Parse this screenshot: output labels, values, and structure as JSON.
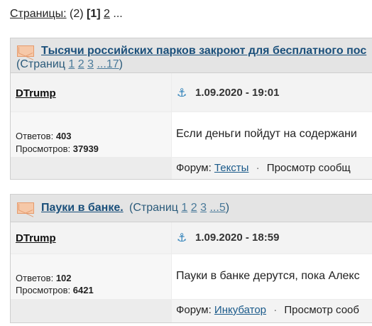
{
  "pagination": {
    "label": "Страницы:",
    "count": "(2)",
    "current": "[1]",
    "next": "2",
    "more": "..."
  },
  "topics": [
    {
      "title": "Тысячи российских парков закроют для бесплатного пос",
      "pages_open": "(Страниц",
      "pages": [
        "1",
        "2",
        "3",
        "...17"
      ],
      "pages_close": ")",
      "author": "DTrump",
      "date": "1.09.2020 - 19:01",
      "replies_label": "Ответов:",
      "replies": "403",
      "views_label": "Просмотров:",
      "views": "37939",
      "excerpt": "Если деньги пойдут на содержани",
      "forum_label": "Форум:",
      "forum": "Тексты",
      "sep": "·",
      "view_label": "Просмотр сообщ"
    },
    {
      "title": "Пауки в банке.",
      "pages_open": "(Страниц",
      "pages": [
        "1",
        "2",
        "3",
        "...5"
      ],
      "pages_close": ")",
      "author": "DTrump",
      "date": "1.09.2020 - 18:59",
      "replies_label": "Ответов:",
      "replies": "102",
      "views_label": "Просмотров:",
      "views": "6421",
      "excerpt": "Пауки в банке дерутся, пока Алекс",
      "forum_label": "Форум:",
      "forum": "Инкубатор",
      "sep": "·",
      "view_label": "Просмотр сооб"
    }
  ],
  "icons": {
    "topic": "envelope-icon",
    "anchor": "anchor-icon"
  },
  "colors": {
    "link": "#1a4f7a",
    "anchor": "#2c7fb8",
    "envelope": "#f6c8a8"
  }
}
